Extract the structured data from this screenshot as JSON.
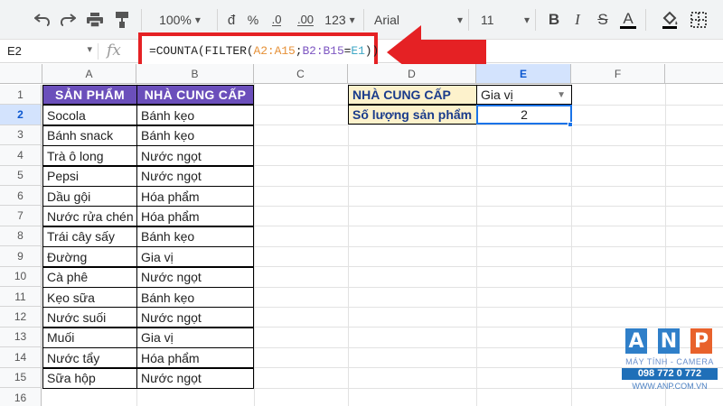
{
  "toolbar": {
    "zoom": "100%",
    "currency": "đ",
    "percent": "%",
    "decimal_decrease": ".0",
    "decimal_increase": ".00",
    "more_formats": "123",
    "font": "Arial",
    "font_size": "11",
    "bold": "B",
    "italic": "I",
    "strikethrough": "S",
    "text_color": "A"
  },
  "formula_bar": {
    "cell_ref": "E2",
    "fx": "fx",
    "formula_parts": [
      "=COUNTA(FILTER(",
      "A2:A15",
      ";",
      "B2:B15",
      "=",
      "E1",
      "))"
    ]
  },
  "columns": [
    "A",
    "B",
    "C",
    "D",
    "E",
    "F"
  ],
  "rows": [
    "1",
    "2",
    "3",
    "4",
    "5",
    "6",
    "7",
    "8",
    "9",
    "10",
    "11",
    "12",
    "13",
    "14",
    "15",
    "16"
  ],
  "table": {
    "headers": [
      "SẢN PHẨM",
      "NHÀ CUNG CẤP"
    ],
    "rows": [
      [
        "Socola",
        "Bánh kẹo"
      ],
      [
        "Bánh snack",
        "Bánh kẹo"
      ],
      [
        "Trà ô long",
        "Nước ngọt"
      ],
      [
        "Pepsi",
        "Nước ngọt"
      ],
      [
        "Dầu gội",
        "Hóa phẩm"
      ],
      [
        "Nước rửa chén",
        "Hóa phẩm"
      ],
      [
        "Trái cây sấy",
        "Bánh kẹo"
      ],
      [
        "Đường",
        "Gia vị"
      ],
      [
        "Cà phê",
        "Nước ngọt"
      ],
      [
        "Kẹo sữa",
        "Bánh kẹo"
      ],
      [
        "Nước suối",
        "Nước ngọt"
      ],
      [
        "Muối",
        "Gia vị"
      ],
      [
        "Nước tẩy",
        "Hóa phẩm"
      ],
      [
        "Sữa hộp",
        "Nước ngọt"
      ]
    ]
  },
  "criteria": {
    "label1": "NHÀ CUNG CẤP",
    "value1": "Gia vị",
    "label2": "Số lượng sản phẩm",
    "value2": "2"
  },
  "logo": {
    "letters": [
      "A",
      "N",
      "P"
    ],
    "tagline": "MÁY TÍNH - CAMERA",
    "phone": "098 772 0 772",
    "url": "WWW.ANP.COM.VN"
  },
  "colors": {
    "header_purple": "#6b4fbb",
    "criteria_yellow": "#fdf2cc",
    "arrow_red": "#e52124",
    "selection_blue": "#1a73e8"
  }
}
